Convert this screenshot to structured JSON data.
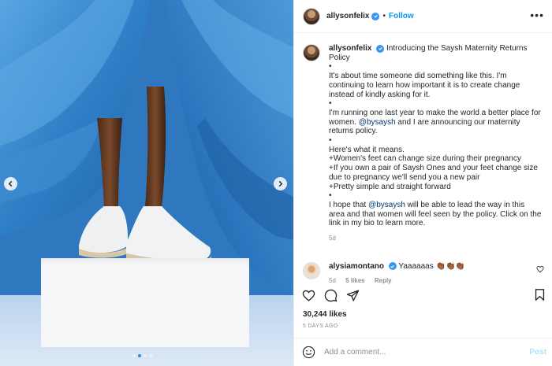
{
  "header": {
    "username": "allysonfelix",
    "separator": "•",
    "follow_label": "Follow",
    "more_icon": "more-horizontal-icon"
  },
  "caption": {
    "username": "allysonfelix",
    "lines": [
      "Introducing the Saysh Maternity Returns Policy",
      "•",
      "It's about time someone did something like this. I'm continuing to learn how important it is to create change instead of kindly asking for it.",
      "•",
      "I'm running one last year to make the world a better place for women.",
      "@bysaysh",
      "and I are announcing our maternity returns policy.",
      "•",
      "Here's what it means.",
      "+Women's feet can change size during their pregnancy",
      "+If you own a pair of Saysh Ones and your feet change size due to pregnancy we'll send you a new pair",
      "+Pretty simple and straight forward",
      "•",
      "I hope that",
      "@bysaysh",
      "will be able to lead the way in this area and that women will feel seen by the policy. Click on the link in my bio to learn more."
    ],
    "time": "5d"
  },
  "comment": {
    "username": "alysiamontano",
    "text": "Yaaaaaas 👏🏾👏🏾👏🏾",
    "time": "5d",
    "likes": "5 likes",
    "reply_label": "Reply"
  },
  "post": {
    "likes": "30,244 likes",
    "posted_ago": "5 DAYS AGO"
  },
  "composer": {
    "placeholder": "Add a comment...",
    "post_label": "Post"
  },
  "carousel": {
    "dot_count": 4,
    "active_index": 1
  },
  "colors": {
    "accent": "#0095f6",
    "verified": "#3897f0",
    "post_disabled": "#b2dffc",
    "muted": "#8e8e8e"
  }
}
